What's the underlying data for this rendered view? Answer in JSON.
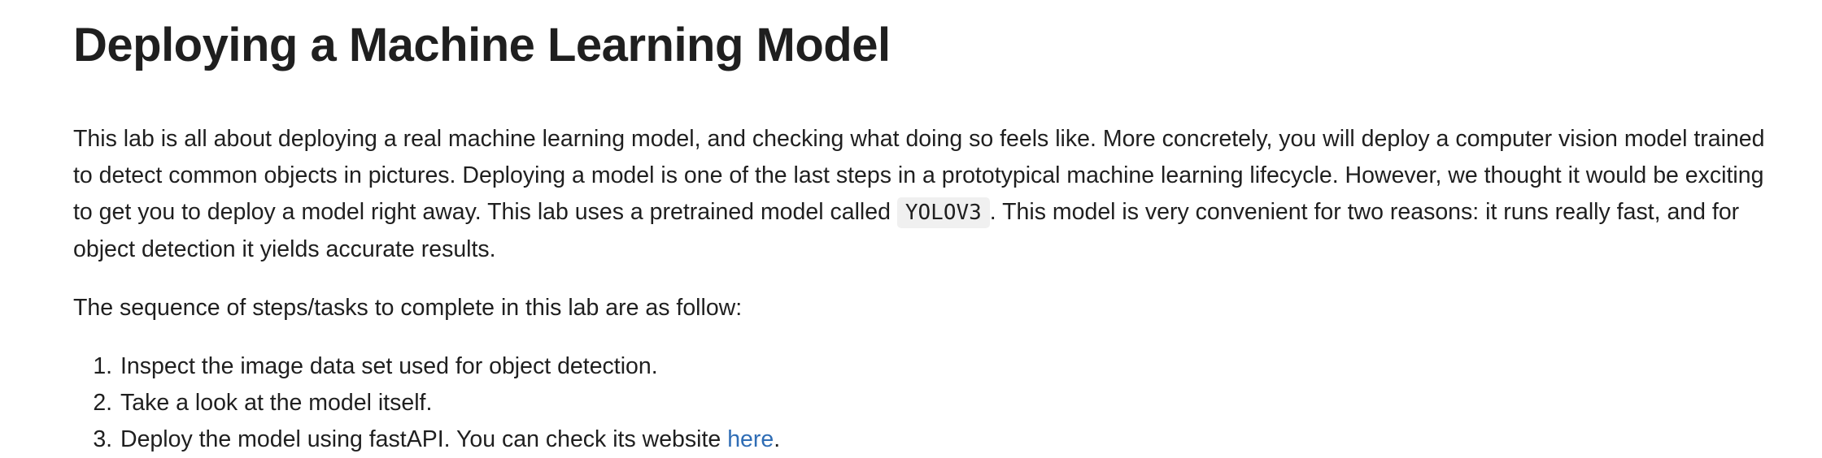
{
  "title": "Deploying a Machine Learning Model",
  "intro": {
    "before_code": "This lab is all about deploying a real machine learning model, and checking what doing so feels like. More concretely, you will deploy a computer vision model trained to detect common objects in pictures. Deploying a model is one of the last steps in a prototypical machine learning lifecycle. However, we thought it would be exciting to get you to deploy a model right away. This lab uses a pretrained model called ",
    "code": "YOLOV3",
    "after_code": ". This model is very convenient for two reasons: it runs really fast, and for object detection it yields accurate results."
  },
  "steps_intro": "The sequence of steps/tasks to complete in this lab are as follow:",
  "steps": [
    {
      "text": "Inspect the image data set used for object detection."
    },
    {
      "text": "Take a look at the model itself."
    },
    {
      "text": "Deploy the model using fastAPI. You can check its website ",
      "link": "here",
      "after": "."
    }
  ],
  "colors": {
    "link": "#2f6db5",
    "text": "#1f1f1f",
    "code_bg": "#f0f0f0"
  }
}
